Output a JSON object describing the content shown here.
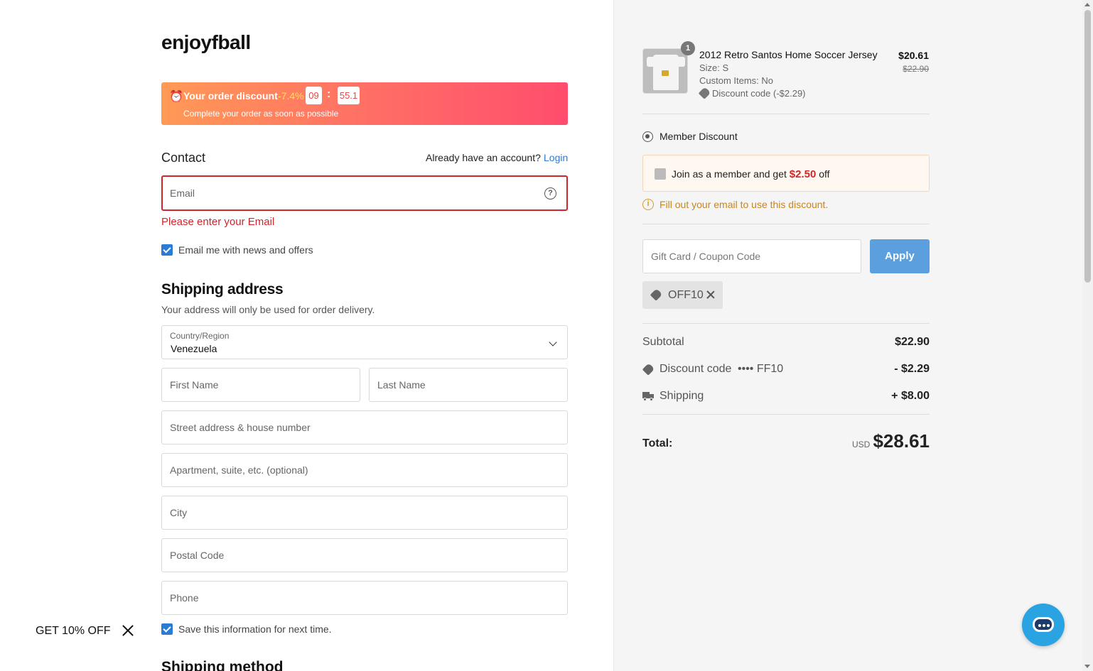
{
  "brand": {
    "logo": "enjoyfball"
  },
  "discount_banner": {
    "title": "Your order discount",
    "percent": "-7.4%",
    "timer_minutes": "09",
    "timer_separator": ":",
    "timer_seconds": "55.1",
    "subtitle": "Complete your order as soon as possible"
  },
  "contact": {
    "title": "Contact",
    "account_prompt": "Already have an account?",
    "login_link": "Login",
    "email_placeholder": "Email",
    "email_error": "Please enter your Email",
    "newsletter_label": "Email me with news and offers",
    "newsletter_checked": true
  },
  "shipping": {
    "title": "Shipping address",
    "subtitle": "Your address will only be used for order delivery.",
    "country_label": "Country/Region",
    "country_value": "Venezuela",
    "first_name_placeholder": "First Name",
    "last_name_placeholder": "Last Name",
    "street_placeholder": "Street address & house number",
    "apartment_placeholder": "Apartment, suite, etc. (optional)",
    "city_placeholder": "City",
    "postal_placeholder": "Postal Code",
    "phone_placeholder": "Phone",
    "save_info_label": "Save this information for next time.",
    "save_info_checked": true,
    "method_title": "Shipping method"
  },
  "promo_popup": {
    "label": "GET 10% OFF"
  },
  "cart": {
    "item": {
      "quantity": "1",
      "name": "2012 Retro Santos Home Soccer Jersey",
      "size": "Size: S",
      "custom": "Custom Items: No",
      "discount": "Discount code (-$2.29)",
      "price": "$20.61",
      "original_price": "$22.90"
    },
    "member": {
      "title": "Member Discount",
      "join_text_before": "Join as a member and get",
      "join_amount": "$2.50",
      "join_text_after": "off",
      "hint": "Fill out your email to use this discount."
    },
    "coupon": {
      "placeholder": "Gift Card / Coupon Code",
      "apply_label": "Apply",
      "applied_code": "OFF10"
    },
    "summary": {
      "subtotal_label": "Subtotal",
      "subtotal_value": "$22.90",
      "discount_label": "Discount code",
      "discount_code_masked": "•••• FF10",
      "discount_value": "- $2.29",
      "shipping_label": "Shipping",
      "shipping_value": "+ $8.00",
      "total_label": "Total:",
      "currency": "USD",
      "total_value": "$28.61"
    }
  },
  "colors": {
    "accent_blue": "#2b7bd3",
    "apply_button": "#5b9fdf",
    "error_red": "#d0252a",
    "banner_start": "#ff9a56",
    "banner_end": "#ff4d6d",
    "chat_button": "#2aa3e3"
  }
}
